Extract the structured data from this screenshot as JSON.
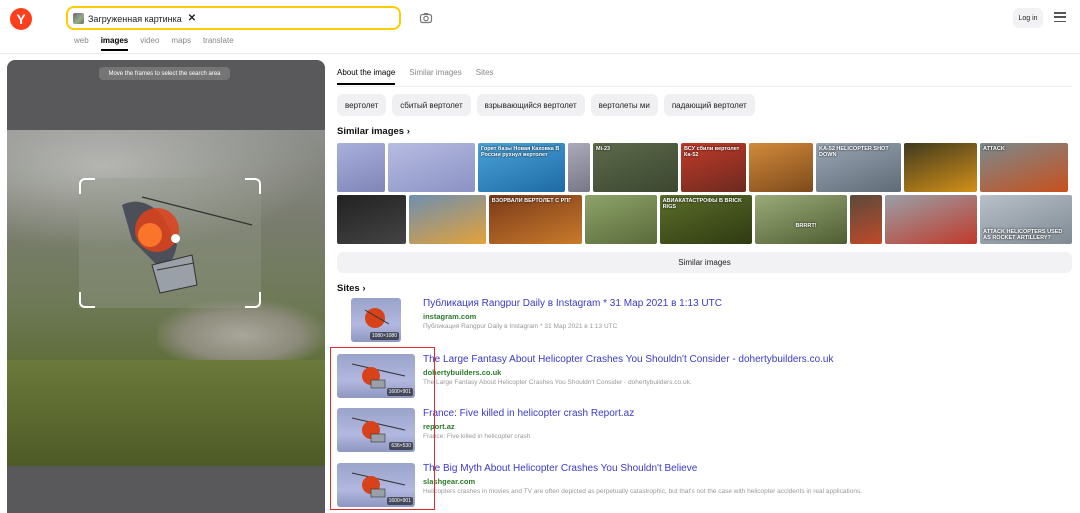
{
  "header": {
    "logo": "Y",
    "search_chip": "Загруженная картинка",
    "login": "Log in",
    "nav_tabs": [
      "web",
      "images",
      "video",
      "maps",
      "translate"
    ],
    "active_tab": "images"
  },
  "preview": {
    "hint": "Move the frames to select the search area"
  },
  "right": {
    "tabs": [
      "About the image",
      "Similar images",
      "Sites"
    ],
    "pills": [
      "вертолет",
      "сбитый вертолет",
      "взрывающийся вертолет",
      "вертолеты ми",
      "падающий вертолет"
    ],
    "similar_title": "Similar images ›",
    "similar_button": "Similar images",
    "sites_title": "Sites ›",
    "tile_captions": {
      "t3": "Горят базы Новая Каховка В России рухнул вертолет",
      "t5": "Mi-23",
      "t6": "ВСУ сбили вертолет Ка-52",
      "t8": "KA-52 HELICOPTER SHOT DOWN",
      "t10": "ATTACK",
      "t13": "ВЗОРВАЛИ ВЕРТОЛЕТ С РПГ",
      "t15": "АВИАКАТАСТРОФЫ В BRICK RIGS",
      "t16": "BRRRT!",
      "t18": "ATTACK HELICOPTERS USED AS ROCKET ARTILLERY?"
    },
    "sites": [
      {
        "title": "Публикация Rangpur Daily в Instagram * 31 Мар 2021 в 1:13 UTC",
        "domain": "instagram.com",
        "snippet": "Публикация Rangpur Daily в Instagram * 31 Мар 2021 в 1:13 UTC",
        "size": "1080×1080"
      },
      {
        "title": "The Large Fantasy About Helicopter Crashes You Shouldn't Consider - dohertybuilders.co.uk",
        "domain": "dohertybuilders.co.uk",
        "snippet": "The Large Fantasy About Helicopter Crashes You Shouldn't Consider - dohertybuilders.co.uk.",
        "size": "1600×901"
      },
      {
        "title": "France: Five killed in helicopter crash Report.az",
        "domain": "report.az",
        "snippet": "France: Five killed in helicopter crash",
        "size": "636×530"
      },
      {
        "title": "The Big Myth About Helicopter Crashes You Shouldn't Believe",
        "domain": "slashgear.com",
        "snippet": "Helicopters crashes in movies and TV are often depicted as perpetually catastrophic, but that's not the case with helicopter accidents in real applications.",
        "size": "1600×901"
      }
    ]
  },
  "colors": {
    "brand": "#fc3f1d",
    "search_border": "#ffcc00",
    "link": "#3a3ac5",
    "domain": "#2c7a2c",
    "highlight_box": "#e32b2b"
  }
}
